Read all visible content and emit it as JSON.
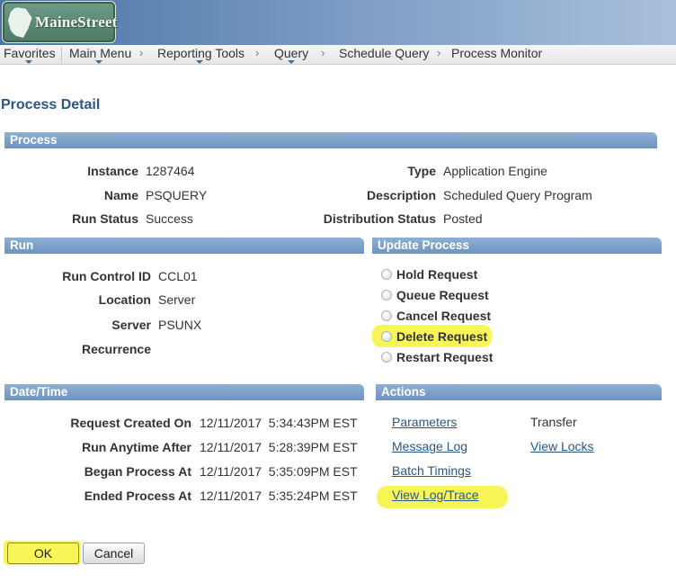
{
  "header": {
    "logo_text": "MaineStreet"
  },
  "nav": {
    "items": [
      {
        "label": "Favorites"
      },
      {
        "label": "Main Menu"
      },
      {
        "label": "Reporting Tools"
      },
      {
        "label": "Query"
      },
      {
        "label": "Schedule Query"
      },
      {
        "label": "Process Monitor"
      }
    ],
    "separator": "›"
  },
  "page_title": "Process Detail",
  "process": {
    "header": "Process",
    "instance_label": "Instance",
    "instance_value": "1287464",
    "name_label": "Name",
    "name_value": "PSQUERY",
    "run_status_label": "Run Status",
    "run_status_value": "Success",
    "type_label": "Type",
    "type_value": "Application Engine",
    "description_label": "Description",
    "description_value": "Scheduled Query Program",
    "distribution_status_label": "Distribution Status",
    "distribution_status_value": "Posted"
  },
  "run": {
    "header": "Run",
    "run_control_label": "Run Control ID",
    "run_control_value": "CCL01",
    "location_label": "Location",
    "location_value": "Server",
    "server_label": "Server",
    "server_value": "PSUNX",
    "recurrence_label": "Recurrence"
  },
  "update_process": {
    "header": "Update Process",
    "options": [
      {
        "label": "Hold Request"
      },
      {
        "label": "Queue Request"
      },
      {
        "label": "Cancel Request"
      },
      {
        "label": "Delete Request"
      },
      {
        "label": "Restart Request"
      }
    ]
  },
  "datetime": {
    "header": "Date/Time",
    "request_created_label": "Request Created On",
    "request_created_value": "12/11/2017  5:34:43PM EST",
    "run_anytime_label": "Run Anytime After",
    "run_anytime_value": "12/11/2017  5:28:39PM EST",
    "began_label": "Began Process At",
    "began_value": "12/11/2017  5:35:09PM EST",
    "ended_label": "Ended Process At",
    "ended_value": "12/11/2017  5:35:24PM EST"
  },
  "actions": {
    "header": "Actions",
    "parameters": "Parameters",
    "message_log": "Message Log",
    "batch_timings": "Batch Timings",
    "view_log_trace": "View Log/Trace",
    "transfer": "Transfer",
    "view_locks": "View Locks"
  },
  "buttons": {
    "ok": "OK",
    "cancel": "Cancel"
  },
  "colors": {
    "header_blue": "#4a74a6",
    "section_blue": "#7fa2c9",
    "link": "#2a5785",
    "highlight": "#f6f33a"
  }
}
